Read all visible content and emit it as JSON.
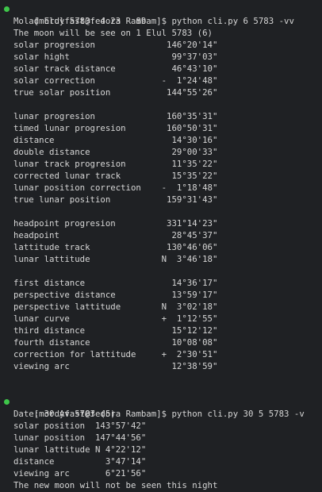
{
  "commands": [
    {
      "prompt": "[mordyfast@fedora Rambam]$ python cli.py 6 5783 -vv",
      "groups": [
        [
          "Molad Elul 5783: 4 23   89",
          "The moon will be see on 1 Elul 5783 (6)",
          "solar progresion              146°20'14\"",
          "solar hight                    99°37'03\"",
          "solar track distance           46°43'10\"",
          "solar correction             -  1°24'48\"",
          "true solar position           144°55'26\""
        ],
        [
          "lunar progresion              160°35'31\"",
          "timed lunar progresion        160°50'31\"",
          "distance                       14°30'16\"",
          "double distance                29°00'33\"",
          "lunar track progresion         11°35'22\"",
          "corrected lunar track          15°35'22\"",
          "lunar position correction    -  1°18'48\"",
          "true lunar position           159°31'43\""
        ],
        [
          "headpoint progresion          331°14'23\"",
          "headpoint                      28°45'37\"",
          "lattitude track               130°46'06\"",
          "lunar lattitude              N  3°46'18\""
        ],
        [
          "first distance                 14°36'17\"",
          "perspective distance           13°59'17\"",
          "perspective lattitude        N  3°02'18\"",
          "lunar curve                  +  1°12'55\"",
          "third distance                 15°12'12\"",
          "fourth distance                10°08'08\"",
          "correction for lattitude     +  2°30'51\"",
          "viewing arc                    12°38'59\""
        ]
      ]
    },
    {
      "prompt": "[mordyfast@fedora Rambam]$ python cli.py 30 5 5783 -v",
      "groups": [
        [
          "Date: 30 Av 5783 (5)",
          "solar position  143°57'42\"",
          "lunar position  147°44'56\"",
          "lunar lattitude N 4°22'12\"",
          "distance          3°47'14\"",
          "viewing arc       6°21'56\"",
          "The new moon will not be seen this night"
        ]
      ]
    }
  ],
  "colors": {
    "background": "#1f2124",
    "text": "#d6d6d6",
    "prompt_dot": "#3ec64a"
  }
}
